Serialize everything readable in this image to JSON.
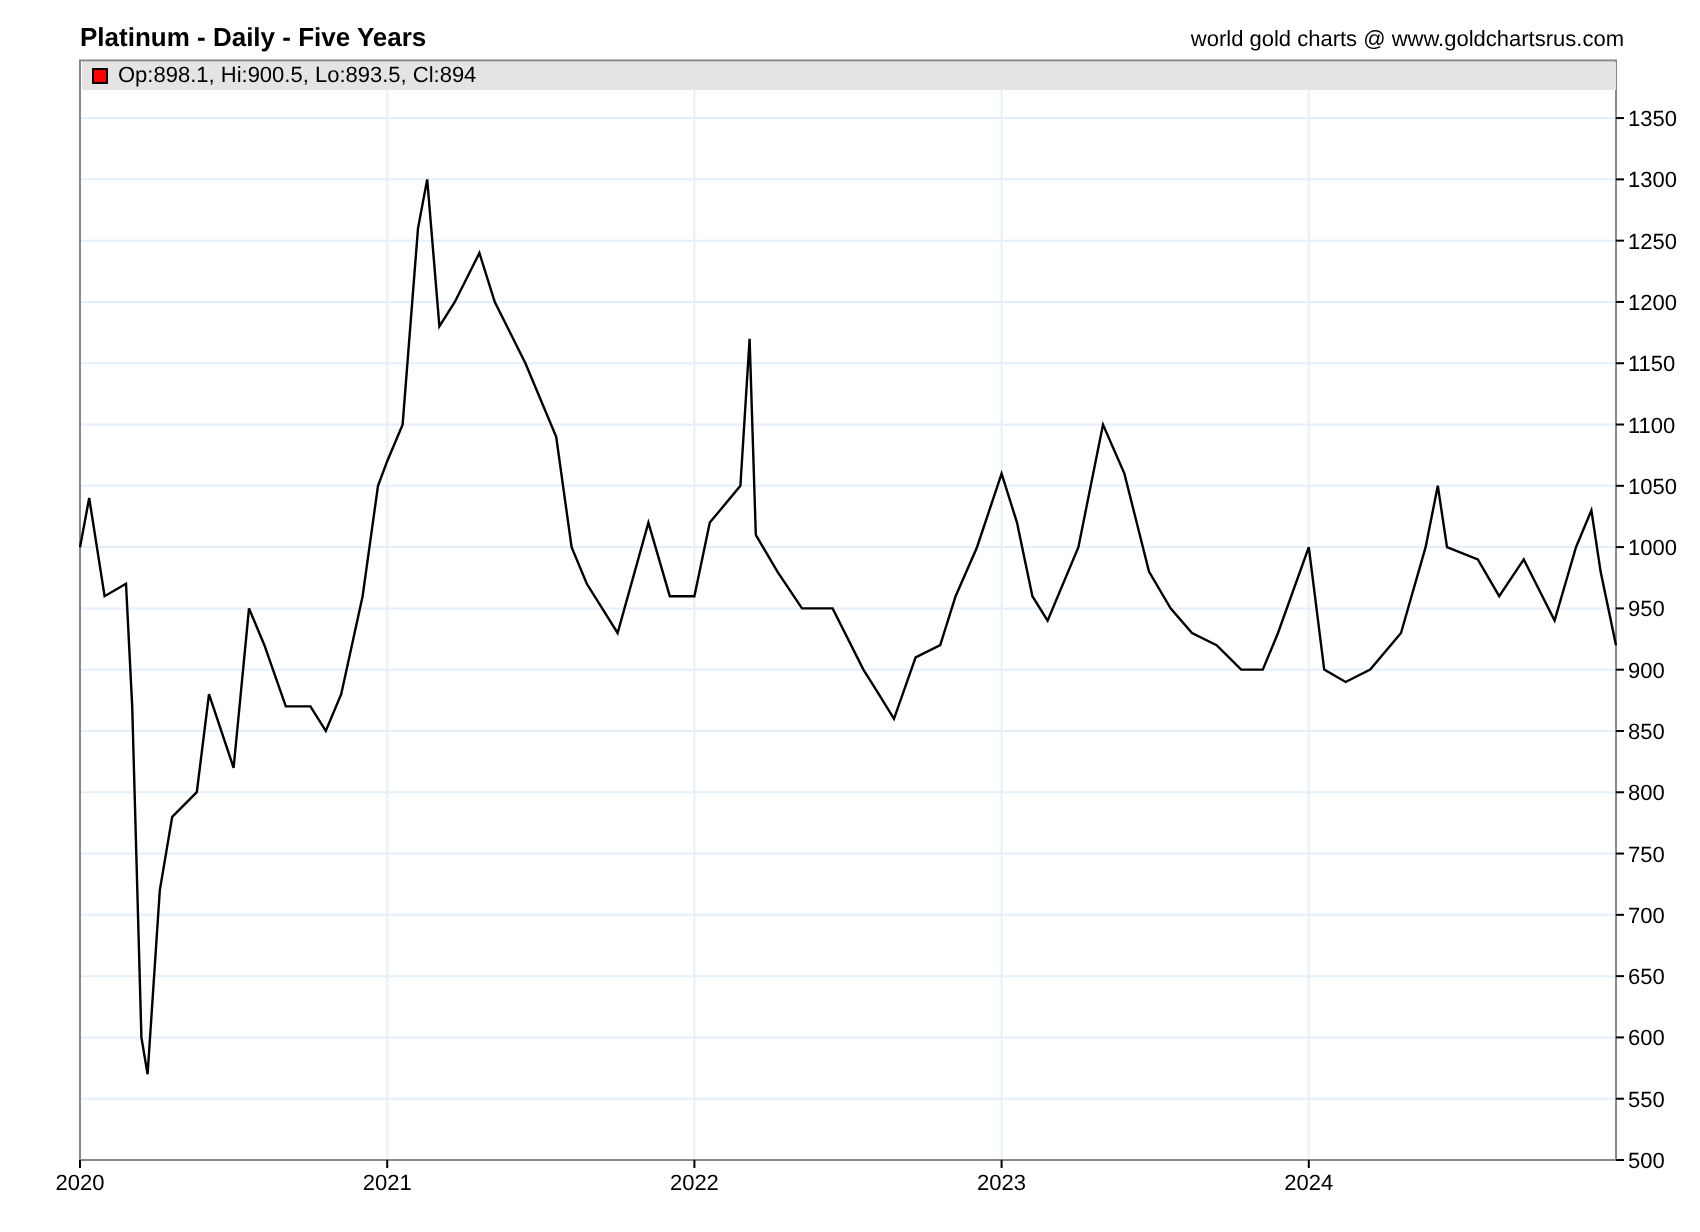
{
  "title": "Platinum - Daily - Five Years",
  "credit": "world gold charts @ www.goldchartsrus.com",
  "chart": {
    "legend": "Op:898.1, Hi:900.5, Lo:893.5, Cl:894",
    "chart_data": {
      "type": "line",
      "xlim": [
        2020,
        2025
      ],
      "ylim": [
        500,
        1397
      ],
      "grid": true,
      "xticks": [
        {
          "value": 2020,
          "label": "2020"
        },
        {
          "value": 2021,
          "label": "2021"
        },
        {
          "value": 2022,
          "label": "2022"
        },
        {
          "value": 2023,
          "label": "2023"
        },
        {
          "value": 2024,
          "label": "2024"
        }
      ],
      "yticks": [
        500,
        550,
        600,
        650,
        700,
        750,
        800,
        850,
        900,
        950,
        1000,
        1050,
        1100,
        1150,
        1200,
        1250,
        1300,
        1350
      ],
      "x": [
        2020,
        2020.03,
        2020.08,
        2020.15,
        2020.17,
        2020.2,
        2020.22,
        2020.26,
        2020.3,
        2020.38,
        2020.42,
        2020.5,
        2020.55,
        2020.6,
        2020.67,
        2020.75,
        2020.8,
        2020.85,
        2020.92,
        2020.97,
        2021,
        2021.05,
        2021.1,
        2021.13,
        2021.17,
        2021.22,
        2021.3,
        2021.35,
        2021.45,
        2021.55,
        2021.6,
        2021.65,
        2021.7,
        2021.75,
        2021.85,
        2021.92,
        2022,
        2022.05,
        2022.15,
        2022.18,
        2022.2,
        2022.27,
        2022.35,
        2022.45,
        2022.55,
        2022.6,
        2022.65,
        2022.72,
        2022.8,
        2022.85,
        2022.92,
        2023,
        2023.05,
        2023.1,
        2023.15,
        2023.25,
        2023.33,
        2023.4,
        2023.48,
        2023.55,
        2023.62,
        2023.7,
        2023.78,
        2023.85,
        2023.9,
        2024,
        2024.05,
        2024.12,
        2024.2,
        2024.3,
        2024.38,
        2024.42,
        2024.45,
        2024.55,
        2024.62,
        2024.7,
        2024.8,
        2024.87,
        2024.92,
        2024.95,
        2025
      ],
      "series": [
        {
          "color": "#000000",
          "values": [
            1000,
            1040,
            960,
            970,
            870,
            600,
            570,
            720,
            780,
            800,
            880,
            820,
            950,
            920,
            870,
            870,
            850,
            880,
            960,
            1050,
            1070,
            1100,
            1260,
            1300,
            1180,
            1200,
            1240,
            1200,
            1150,
            1090,
            1000,
            970,
            950,
            930,
            1020,
            960,
            960,
            1020,
            1050,
            1170,
            1010,
            980,
            950,
            950,
            900,
            880,
            860,
            910,
            920,
            960,
            1000,
            1060,
            1020,
            960,
            940,
            1000,
            1100,
            1060,
            980,
            950,
            930,
            920,
            900,
            900,
            930,
            1000,
            900,
            890,
            900,
            930,
            1000,
            1050,
            1000,
            990,
            960,
            990,
            940,
            1000,
            1030,
            980,
            920
          ]
        }
      ]
    }
  }
}
